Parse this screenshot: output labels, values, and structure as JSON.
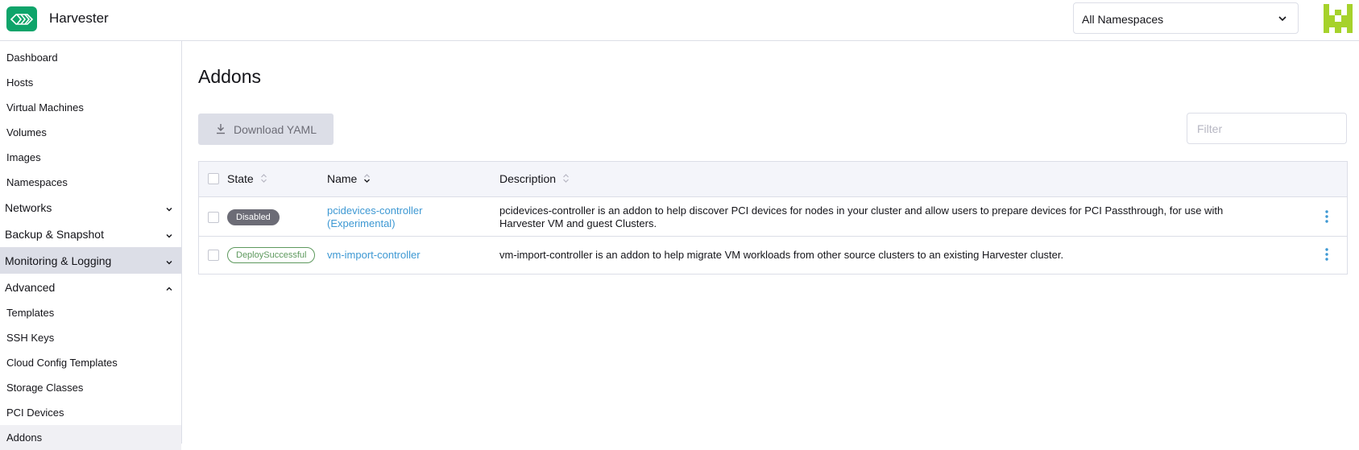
{
  "header": {
    "app_title": "Harvester",
    "namespace_select": "All Namespaces"
  },
  "sidebar": {
    "items": [
      {
        "label": "Dashboard"
      },
      {
        "label": "Hosts"
      },
      {
        "label": "Virtual Machines"
      },
      {
        "label": "Volumes"
      },
      {
        "label": "Images"
      },
      {
        "label": "Namespaces"
      }
    ],
    "groups": [
      {
        "label": "Networks",
        "expanded": false
      },
      {
        "label": "Backup & Snapshot",
        "expanded": false
      },
      {
        "label": "Monitoring & Logging",
        "expanded": false
      },
      {
        "label": "Advanced",
        "expanded": true
      }
    ],
    "advanced_items": [
      {
        "label": "Templates"
      },
      {
        "label": "SSH Keys"
      },
      {
        "label": "Cloud Config Templates"
      },
      {
        "label": "Storage Classes"
      },
      {
        "label": "PCI Devices"
      },
      {
        "label": "Addons",
        "active": true
      }
    ]
  },
  "main": {
    "title": "Addons",
    "download_label": "Download YAML",
    "filter_placeholder": "Filter",
    "table": {
      "columns": [
        "State",
        "Name",
        "Description"
      ],
      "rows": [
        {
          "state": "Disabled",
          "name_line1": "pcidevices-controller",
          "name_line2": "(Experimental)",
          "description": "pcidevices-controller is an addon to help discover PCI devices for nodes in your cluster and allow users to prepare devices for PCI Passthrough, for use with Harvester VM and guest Clusters."
        },
        {
          "state": "DeploySuccessful",
          "name_line1": "vm-import-controller",
          "description": "vm-import-controller is an addon to help migrate VM workloads from other source clusters to an existing Harvester cluster."
        }
      ]
    }
  },
  "colors": {
    "accent_link": "#3d98d3",
    "brand_green": "#0ea46a",
    "badge_disabled": "#6c6c76",
    "badge_success": "#5d995d",
    "avatar_green": "#a6d22b"
  }
}
